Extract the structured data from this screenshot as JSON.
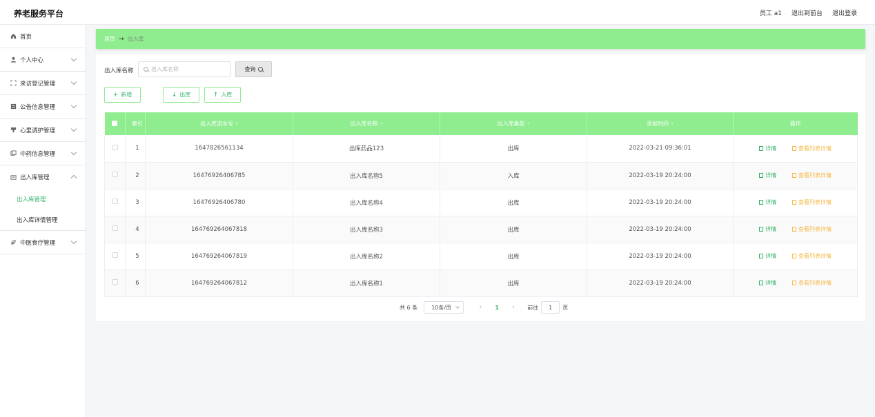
{
  "header": {
    "app_title": "养老服务平台",
    "user_label": "员工 a1",
    "back_to_front": "退出到前台",
    "logout": "退出登录"
  },
  "sidebar": {
    "items": [
      {
        "label": "首页",
        "icon": "home-icon"
      },
      {
        "label": "个人中心",
        "icon": "user-icon"
      },
      {
        "label": "来访登记管理",
        "icon": "scan-icon"
      },
      {
        "label": "公告信息管理",
        "icon": "notice-icon"
      },
      {
        "label": "心里调护管理",
        "icon": "care-icon"
      },
      {
        "label": "中药信息管理",
        "icon": "herb-icon"
      },
      {
        "label": "出入库管理",
        "icon": "warehouse-icon"
      },
      {
        "label": "中医食疗管理",
        "icon": "diet-icon"
      }
    ],
    "sub_items": [
      {
        "label": "出入库管理"
      },
      {
        "label": "出入库详情管理"
      }
    ]
  },
  "breadcrumb": {
    "home": "首页",
    "arrow": "→",
    "current": "出入库"
  },
  "search": {
    "label": "出入库名称",
    "placeholder": "出入库名称",
    "button": "查询"
  },
  "actions": {
    "add": "新增",
    "out": "出库",
    "in": "入库"
  },
  "table": {
    "headers": {
      "index": "索引",
      "serial": "出入库流水号",
      "name": "出入库名称",
      "type": "出入库类型",
      "time": "添加时间",
      "ops": "操作"
    },
    "detail_label": "详情",
    "list_label": "查看列表详情",
    "rows": [
      {
        "index": "1",
        "serial": "1647826561134",
        "name": "出库药品123",
        "type": "出库",
        "time": "2022-03-21 09:36:01"
      },
      {
        "index": "2",
        "serial": "16476926406785",
        "name": "出入库名称5",
        "type": "入库",
        "time": "2022-03-19 20:24:00"
      },
      {
        "index": "3",
        "serial": "16476926406780",
        "name": "出入库名称4",
        "type": "出库",
        "time": "2022-03-19 20:24:00"
      },
      {
        "index": "4",
        "serial": "164769264067818",
        "name": "出入库名称3",
        "type": "出库",
        "time": "2022-03-19 20:24:00"
      },
      {
        "index": "5",
        "serial": "164769264067819",
        "name": "出入库名称2",
        "type": "出库",
        "time": "2022-03-19 20:24:00"
      },
      {
        "index": "6",
        "serial": "164769264067812",
        "name": "出入库名称1",
        "type": "出库",
        "time": "2022-03-19 20:24:00"
      }
    ]
  },
  "pagination": {
    "total": "共 6 条",
    "page_size": "10条/页",
    "current": "1",
    "goto_label": "前往",
    "goto_value": "1",
    "page_suffix": "页"
  },
  "colors": {
    "accent": "#8fec8f",
    "active_text": "#35b36a",
    "warning": "#f5b94a"
  }
}
